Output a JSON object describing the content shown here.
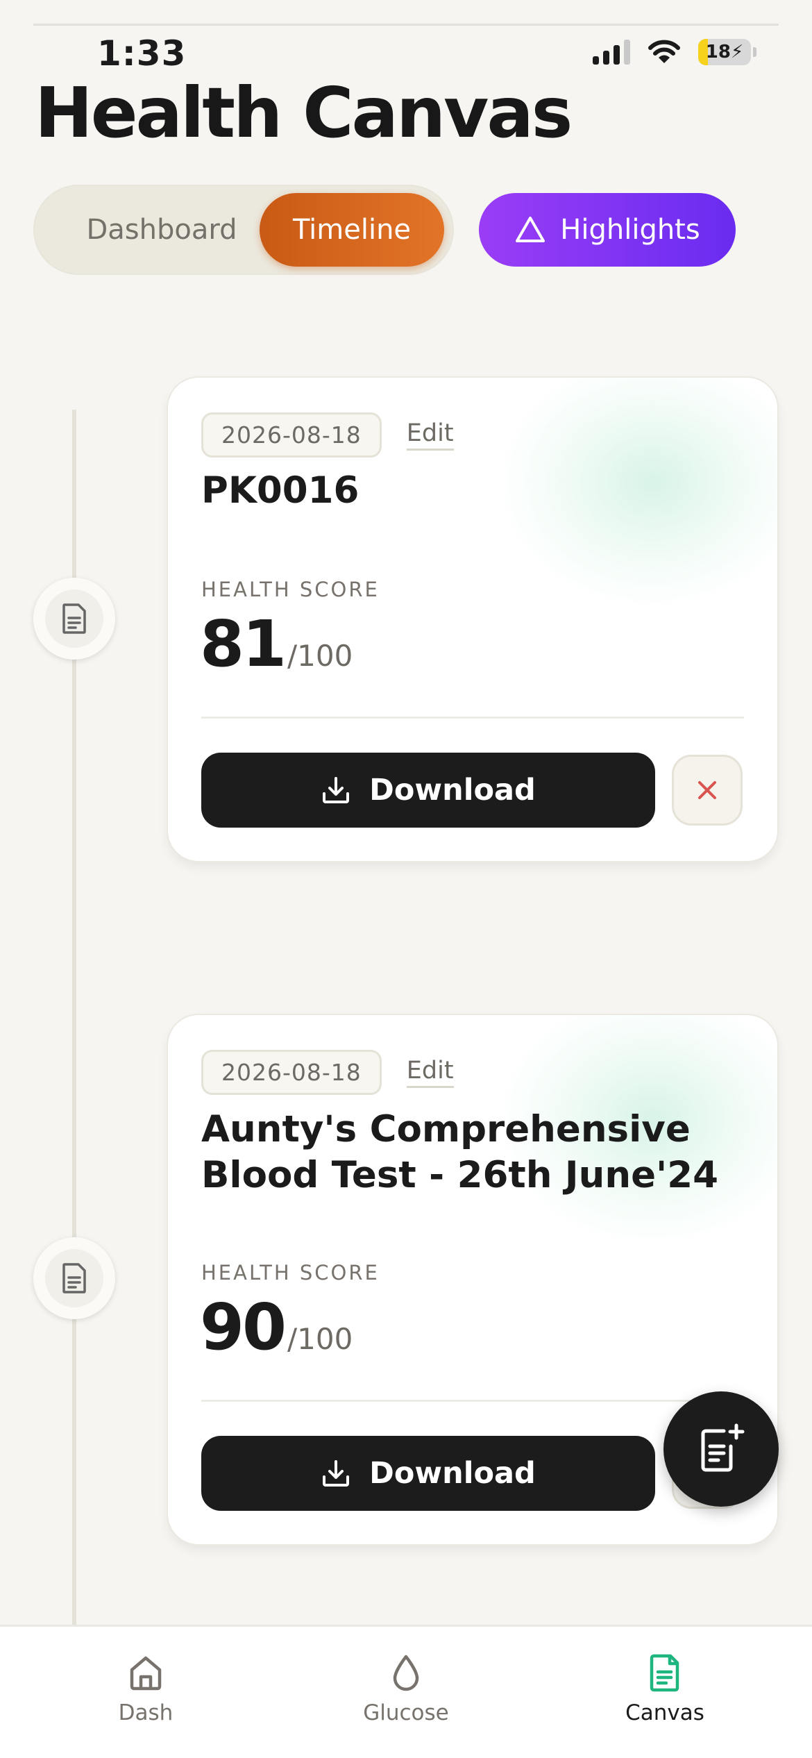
{
  "status_bar": {
    "time": "1:33",
    "battery_level": "18",
    "battery_fraction": 0.18
  },
  "header": {
    "title": "Health Canvas"
  },
  "tabs": [
    {
      "label": "Dashboard",
      "active": false
    },
    {
      "label": "Timeline",
      "active": true
    }
  ],
  "highlights": {
    "label": "Highlights",
    "icon": "triangle-icon"
  },
  "reports": [
    {
      "date": "2026-08-18",
      "edit_label": "Edit",
      "title": "PK0016",
      "score_label": "HEALTH SCORE",
      "score": "81",
      "score_max": "/100",
      "download_label": "Download"
    },
    {
      "date": "2026-08-18",
      "edit_label": "Edit",
      "title": "Aunty's Comprehensive Blood Test - 26th June'24",
      "score_label": "HEALTH SCORE",
      "score": "90",
      "score_max": "/100",
      "download_label": "Download"
    }
  ],
  "bottom_nav": [
    {
      "label": "Dash",
      "icon": "home-icon",
      "active": false
    },
    {
      "label": "Glucose",
      "icon": "droplet-icon",
      "active": false
    },
    {
      "label": "Canvas",
      "icon": "document-icon",
      "active": true
    }
  ],
  "colors": {
    "accent_orange": "#e27428",
    "accent_purple": "#8a35f4",
    "canvas_green": "#1fb57f",
    "close_red": "#d9534f"
  }
}
